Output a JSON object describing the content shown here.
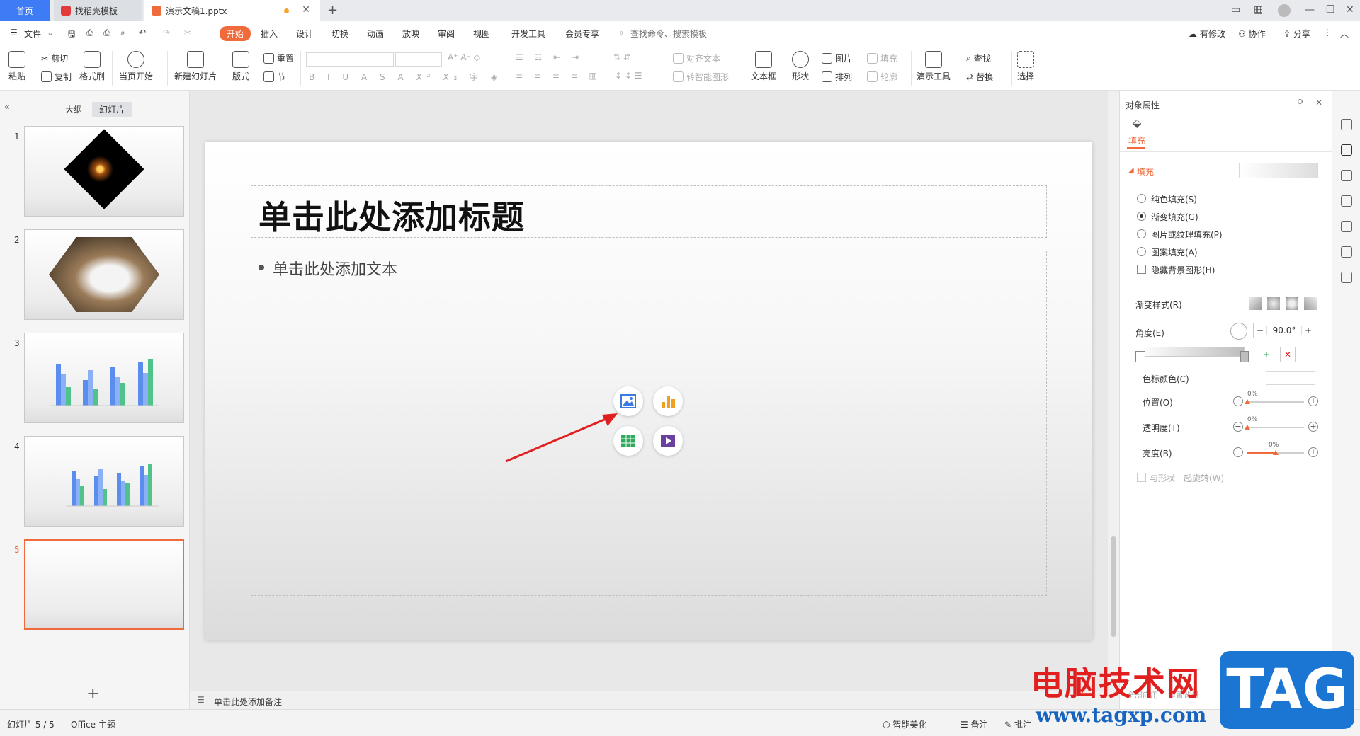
{
  "titlebar": {
    "home_tab": "首页",
    "template_tab": "找稻壳模板",
    "doc_tab": "演示文稿1.pptx",
    "new_tab": "+"
  },
  "menu": {
    "file": "文件",
    "items": [
      "开始",
      "插入",
      "设计",
      "切换",
      "动画",
      "放映",
      "审阅",
      "视图",
      "开发工具",
      "会员专享"
    ],
    "search_placeholder": "查找命令、搜索模板",
    "right": {
      "modified": "有修改",
      "collab": "协作",
      "share": "分享"
    }
  },
  "ribbon": {
    "paste": "粘贴",
    "cut": "剪切",
    "copy": "复制",
    "format_painter": "格式刷",
    "from_current": "当页开始",
    "new_slide": "新建幻灯片",
    "layout": "版式",
    "section": "节",
    "reset": "重置",
    "align_text": "对齐文本",
    "smart_art": "转智能图形",
    "textbox": "文本框",
    "shape": "形状",
    "picture": "图片",
    "fill": "填充",
    "arrange": "排列",
    "outline": "轮廓",
    "present_tools": "演示工具",
    "find": "查找",
    "replace": "替换",
    "select": "选择"
  },
  "left_panel": {
    "tab_outline": "大纲",
    "tab_slides": "幻灯片",
    "slides": [
      {
        "num": "1"
      },
      {
        "num": "2"
      },
      {
        "num": "3"
      },
      {
        "num": "4"
      },
      {
        "num": "5"
      }
    ],
    "add": "+"
  },
  "slide": {
    "title_placeholder": "单击此处添加标题",
    "body_placeholder": "单击此处添加文本"
  },
  "notes": {
    "placeholder": "单击此处添加备注"
  },
  "right_panel": {
    "header": "对象属性",
    "tab_fill": "填充",
    "section_fill": "填充",
    "options": [
      {
        "label": "纯色填充(S)",
        "checked": false
      },
      {
        "label": "渐变填充(G)",
        "checked": true
      },
      {
        "label": "图片或纹理填充(P)",
        "checked": false
      },
      {
        "label": "图案填充(A)",
        "checked": false
      }
    ],
    "hide_bg": "隐藏背景图形(H)",
    "gradient_style": "渐变样式(R)",
    "angle_label": "角度(E)",
    "angle_value": "90.0°",
    "stop_color": "色标颜色(C)",
    "position_label": "位置(O)",
    "position_value": "0%",
    "transparency_label": "透明度(T)",
    "transparency_value": "0%",
    "brightness_label": "亮度(B)",
    "brightness_value": "0%",
    "rotate_with_shape": "与形状一起旋转(W)",
    "apply_all": "全部应用",
    "reset_bg": "重置背景"
  },
  "statusbar": {
    "slide_count": "幻灯片 5 / 5",
    "theme": "Office 主题",
    "beautify": "智能美化",
    "notes": "备注",
    "comments": "批注"
  },
  "watermark": {
    "site_name": "电脑技术网",
    "url": "www.tagxp.com",
    "logo": "TAG"
  },
  "colors": {
    "accent": "#f06a3c",
    "home_tab": "#3d7cf5"
  }
}
